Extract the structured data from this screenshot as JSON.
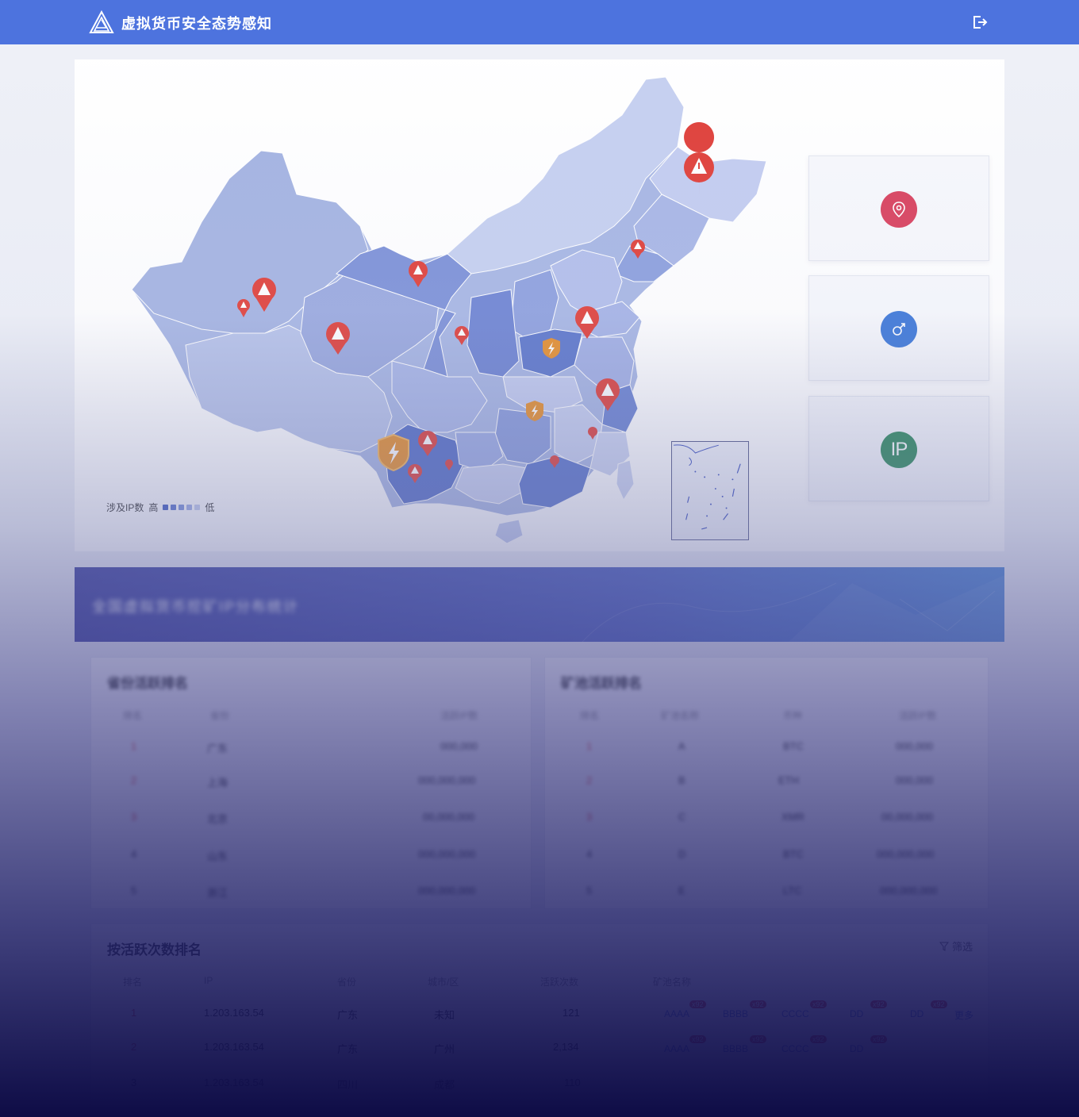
{
  "header": {
    "app_title": "虚拟货币安全态势感知",
    "logo_icon": "triangle-logo-icon",
    "logout_icon": "logout-icon"
  },
  "map": {
    "legend": {
      "label": "涉及IP数",
      "high": "高",
      "low": "低",
      "swatches": [
        "#3f5bc2",
        "#5a74cf",
        "#7b91db",
        "#9eaee6",
        "#c3cdef"
      ]
    },
    "marker_colors": {
      "alert": "#e0413b",
      "shield": "#e8902b"
    }
  },
  "stat_cards": [
    {
      "icon": "location-pin-icon",
      "color": "#d9435f"
    },
    {
      "icon": "link-icon",
      "color": "#3d78d8"
    },
    {
      "icon": "ip-icon",
      "color": "#2e8a5c",
      "text": "IP"
    }
  ],
  "banner": {
    "title": "全国虚拟货币挖矿IP分布统计"
  },
  "province_rank": {
    "title": "省份活跃排名",
    "headers": [
      "排名",
      "省份",
      "活跃IP数"
    ],
    "rows": [
      [
        "1",
        "广东",
        "000,000"
      ],
      [
        "2",
        "上海",
        "000,000,000"
      ],
      [
        "3",
        "北京",
        "00,000,000"
      ],
      [
        "4",
        "山东",
        "000,000,000"
      ],
      [
        "5",
        "浙江",
        "000,000,000"
      ]
    ]
  },
  "miner_rank": {
    "title": "矿池活跃排名",
    "headers": [
      "排名",
      "矿池名称",
      "币种",
      "活跃IP数"
    ],
    "rows": [
      [
        "1",
        "A",
        "BTC",
        "000,000"
      ],
      [
        "2",
        "B",
        "ETH",
        "000,000"
      ],
      [
        "3",
        "C",
        "XMR",
        "00,000,000"
      ],
      [
        "4",
        "D",
        "BTC",
        "000,000,000"
      ],
      [
        "5",
        "E",
        "LTC",
        "000,000,000"
      ]
    ]
  },
  "activity_rank": {
    "title": "按活跃次数排名",
    "filter_label": "筛选",
    "filter_icon": "funnel-icon",
    "headers": [
      "排名",
      "IP",
      "省份",
      "城市/区",
      "活跃次数",
      "矿池名称"
    ],
    "rows": [
      {
        "rank": "1",
        "ip": "1.203.163.54",
        "province": "广东",
        "city": "未知",
        "count": "121",
        "pools": [
          "AAAA",
          "BBBB",
          "CCCC",
          "DD",
          "DD"
        ],
        "badge": "x92",
        "more": "更多"
      },
      {
        "rank": "2",
        "ip": "1.203.163.54",
        "province": "广东",
        "city": "广州",
        "count": "2,134",
        "pools": [
          "AAAA",
          "BBBB",
          "CCCC",
          "DD"
        ],
        "badge": "x92",
        "more": ""
      },
      {
        "rank": "3",
        "ip": "1.203.163.54",
        "province": "四川",
        "city": "成都",
        "count": "110",
        "pools": [],
        "badge": "",
        "more": ""
      }
    ]
  }
}
